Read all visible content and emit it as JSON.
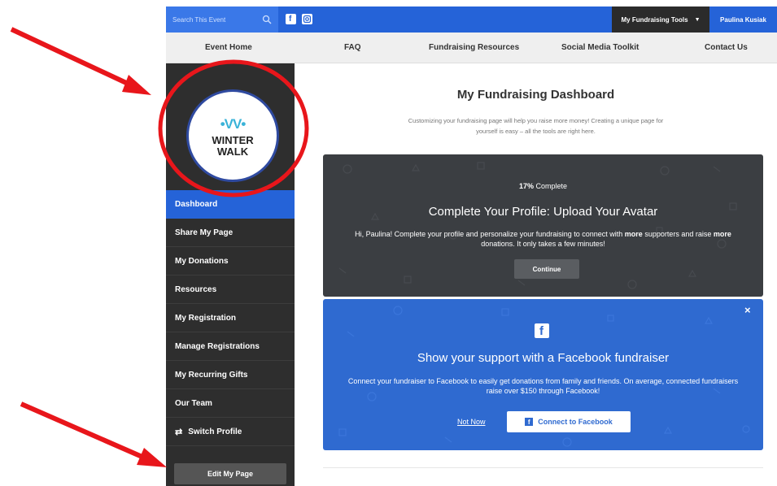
{
  "search": {
    "placeholder": "Search This Event"
  },
  "social": {
    "facebook_icon": "facebook-icon",
    "instagram_icon": "instagram-icon"
  },
  "header": {
    "tools_label": "My Fundraising Tools",
    "user_name": "Paulina Kusiak"
  },
  "nav": {
    "items": [
      {
        "label": "Event Home"
      },
      {
        "label": "FAQ"
      },
      {
        "label": "Fundraising Resources"
      },
      {
        "label": "Social Media Toolkit"
      },
      {
        "label": "Contact Us"
      }
    ]
  },
  "logo": {
    "mark": "•VV•",
    "line1": "WINTER",
    "line2": "WALK"
  },
  "sidebar": {
    "items": [
      {
        "label": "Dashboard",
        "active": true
      },
      {
        "label": "Share My Page"
      },
      {
        "label": "My Donations"
      },
      {
        "label": "Resources"
      },
      {
        "label": "My Registration"
      },
      {
        "label": "Manage Registrations"
      },
      {
        "label": "My Recurring Gifts"
      },
      {
        "label": "Our Team"
      },
      {
        "label": "Switch Profile"
      }
    ],
    "edit_button": "Edit My Page"
  },
  "main": {
    "title": "My Fundraising Dashboard",
    "subtitle": "Customizing your fundraising page will help you raise more money! Creating a unique page for yourself is easy – all the tools are right here."
  },
  "profile_card": {
    "percent": "17%",
    "percent_suffix": " Complete",
    "progress_fraction": 0.17,
    "heading": "Complete Your Profile: Upload Your Avatar",
    "body_1": "Hi, Paulina! Complete your profile and personalize your fundraising to connect with ",
    "body_bold_1": "more",
    "body_2": " supporters and raise ",
    "body_bold_2": "more",
    "body_3": " donations. It only takes a few minutes!",
    "button": "Continue"
  },
  "facebook_card": {
    "close": "×",
    "heading": "Show your support with a Facebook fundraiser",
    "body": "Connect your fundraiser to Facebook to easily get donations from family and friends. On average, connected fundraisers raise over $150 through Facebook!",
    "not_now": "Not Now",
    "connect": "Connect to Facebook"
  },
  "colors": {
    "accent_blue": "#2563d8",
    "sidebar_dark": "#2e2e2e",
    "annotation_red": "#e8161b"
  }
}
